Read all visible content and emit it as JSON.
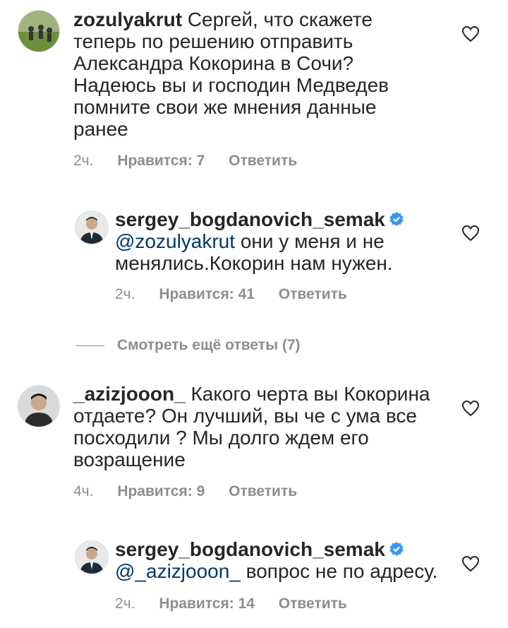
{
  "comments": [
    {
      "username": "zozulyakrut",
      "text": "Сергей, что скажете теперь по решению отправить Александра Кокорина в Сочи? Надеюсь вы и господин Медведев помните свои же мнения данные ранее",
      "lines": [
        "Сергей, что скажете",
        "теперь по решению отправить",
        "Александра Кокорина в Сочи?",
        "Надеюсь вы и господин Медведев",
        "помните свои же мнения данные",
        "ранее"
      ],
      "time": "2ч.",
      "likes": "Нравится: 7",
      "reply": "Ответить"
    },
    {
      "username": "sergey_bogdanovich_semak",
      "mention": "@zozulyakrut",
      "lines": [
        "они у меня и не",
        "менялись.Кокорин нам нужен."
      ],
      "time": "2ч.",
      "likes": "Нравится: 41",
      "reply": "Ответить"
    },
    {
      "view_replies": "Смотреть ещё ответы (7)"
    },
    {
      "username": "_azizjooon_",
      "lines": [
        "Какого черта вы Кокорина",
        "отдаете? Он лучший, вы че с ума все",
        "посходили ? Мы долго ждем его",
        "возращение"
      ],
      "time": "4ч.",
      "likes": "Нравится: 9",
      "reply": "Ответить"
    },
    {
      "username": "sergey_bogdanovich_semak",
      "mention": "@_azizjooon_",
      "lines": [
        "вопрос не по адресу."
      ],
      "time": "2ч.",
      "likes": "Нравится: 14",
      "reply": "Ответить"
    }
  ],
  "colors": {
    "text": "#262626",
    "meta": "#8e8e8e",
    "mention": "#00376b",
    "verified": "#3897f0"
  },
  "icons": [
    "heart-icon",
    "verified-badge-icon"
  ]
}
